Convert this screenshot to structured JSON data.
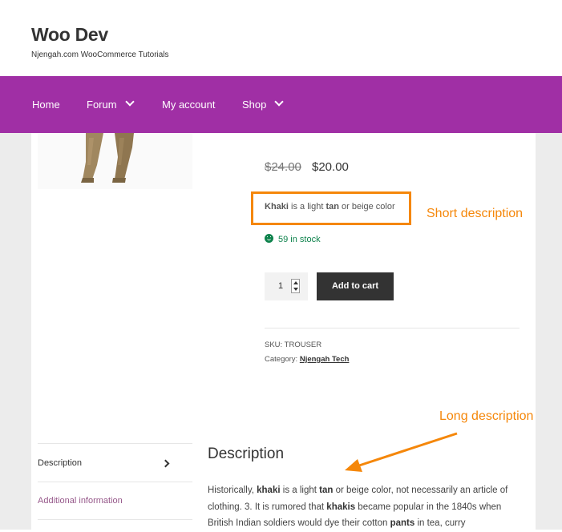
{
  "site": {
    "title": "Woo Dev",
    "tagline": "Njengah.com WooCommerce Tutorials"
  },
  "nav": {
    "items": [
      {
        "label": "Home"
      },
      {
        "label": "Forum"
      },
      {
        "label": "My account"
      },
      {
        "label": "Shop"
      }
    ]
  },
  "colors": {
    "nav_bg": "#a02fa5",
    "annotation": "#f5870a",
    "stock": "#0f834d",
    "button_bg": "#333333"
  },
  "product": {
    "price_old": "$24.00",
    "price_new": "$20.00",
    "short_description": {
      "bold1": "Khaki",
      "text1": " is a light ",
      "bold2": "tan",
      "text2": " or beige color"
    },
    "stock": "59 in stock",
    "quantity": "1",
    "add_to_cart": "Add to cart",
    "sku_label": "SKU:",
    "sku": "TROUSER",
    "category_label": "Category:",
    "category": "Njengah Tech"
  },
  "annotations": {
    "short": "Short description",
    "long": "Long description"
  },
  "tabs": [
    {
      "label": "Description",
      "active": true
    },
    {
      "label": "Additional information",
      "active": false
    }
  ],
  "description": {
    "title": "Description",
    "segments": [
      {
        "t": "Historically, ",
        "b": false
      },
      {
        "t": "khaki",
        "b": true
      },
      {
        "t": " is a light ",
        "b": false
      },
      {
        "t": "tan",
        "b": true
      },
      {
        "t": " or beige color, not necessarily an article of clothing. 3. It is rumored that ",
        "b": false
      },
      {
        "t": "khakis",
        "b": true
      },
      {
        "t": " became popular in the 1840s when British Indian soldiers would dye their cotton ",
        "b": false
      },
      {
        "t": "pants",
        "b": true
      },
      {
        "t": " in tea, curry",
        "b": false
      }
    ]
  }
}
